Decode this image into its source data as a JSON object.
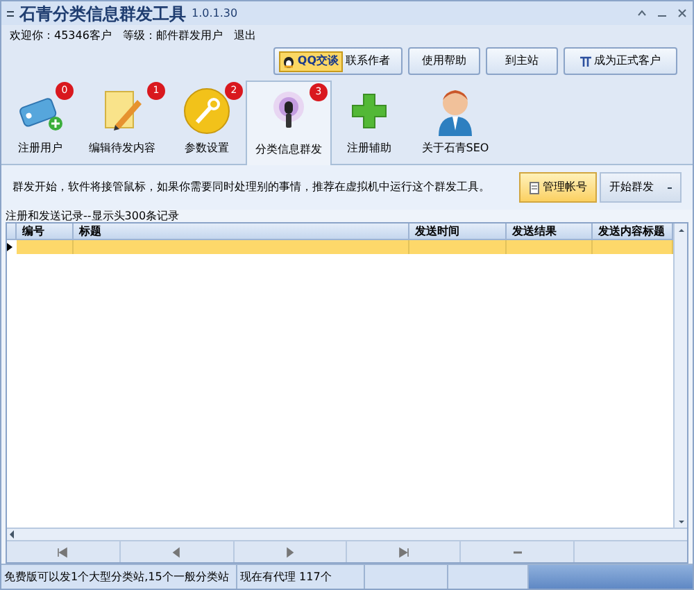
{
  "window": {
    "title": "石青分类信息群发工具",
    "version": "1.0.1.30"
  },
  "user_info": [
    {
      "label": "欢迎你：",
      "value": "45346客户"
    },
    {
      "label": "等级：",
      "value": "邮件群发用户"
    },
    {
      "label": "退出"
    }
  ],
  "top_buttons": [
    {
      "kind": "qq",
      "badge": "QQ交谈",
      "label": "联系作者"
    },
    {
      "kind": "plain",
      "label": "使用帮助"
    },
    {
      "kind": "plain",
      "label": "到主站"
    },
    {
      "kind": "pi",
      "label": "成为正式客户"
    }
  ],
  "tabs": [
    {
      "label": "注册用户",
      "badge": "0",
      "selected": false
    },
    {
      "label": "编辑待发内容",
      "badge": "1",
      "selected": false
    },
    {
      "label": "参数设置",
      "badge": "2",
      "selected": false
    },
    {
      "label": "分类信息群发",
      "badge": "3",
      "selected": true
    },
    {
      "label": "注册辅助",
      "selected": false
    },
    {
      "label": "关于石青SEO",
      "selected": false
    }
  ],
  "notice": "群发开始，软件将接管鼠标，如果你需要同时处理别的事情，推荐在虚拟机中运行这个群发工具。",
  "actions": [
    {
      "label": "管理帐号",
      "highlighted": true
    },
    {
      "label": "开始群发",
      "highlighted": false
    }
  ],
  "records": {
    "caption": "注册和发送记录--显示头300条记录",
    "columns": [
      "编号",
      "标题",
      "发送时间",
      "发送结果",
      "发送内容标题"
    ]
  },
  "status_bar": [
    "免费版可以发1个大型分类站,15个一般分类站",
    "现在有代理 117个"
  ]
}
